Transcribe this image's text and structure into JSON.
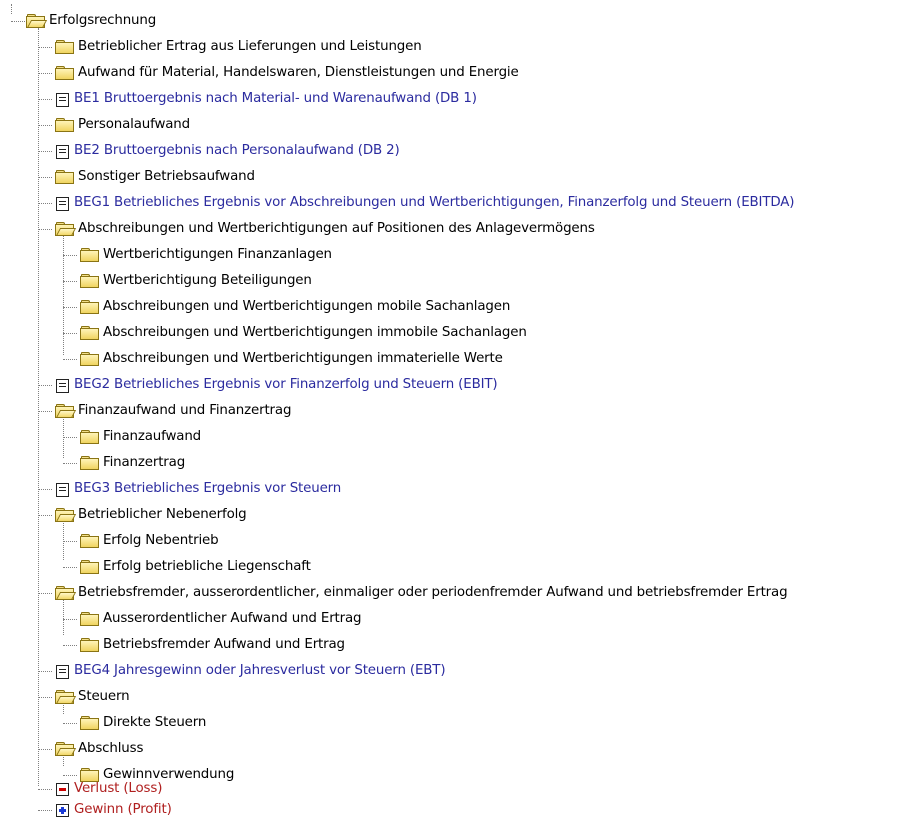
{
  "tree": {
    "root": {
      "label": "Erfolgsrechnung",
      "icon": "folder-open-icon",
      "color": "#000000"
    },
    "items": [
      {
        "label": "Betrieblicher Ertrag aus Lieferungen und Leistungen",
        "icon": "folder-icon",
        "color": "#000000"
      },
      {
        "label": "Aufwand für Material, Handelswaren, Dienstleistungen und Energie",
        "icon": "folder-icon",
        "color": "#000000"
      },
      {
        "label": "BE1 Bruttoergebnis nach Material- und Warenaufwand (DB 1)",
        "icon": "document-icon",
        "color": "#2b2b9f"
      },
      {
        "label": "Personalaufwand",
        "icon": "folder-icon",
        "color": "#000000"
      },
      {
        "label": "BE2 Bruttoergebnis nach Personalaufwand  (DB 2)",
        "icon": "document-icon",
        "color": "#2b2b9f"
      },
      {
        "label": "Sonstiger Betriebsaufwand",
        "icon": "folder-icon",
        "color": "#000000"
      },
      {
        "label": "BEG1 Betriebliches Ergebnis vor Abschreibungen und Wertberichtigungen, Finanzerfolg und Steuern (EBITDA)",
        "icon": "document-icon",
        "color": "#2b2b9f"
      },
      {
        "label": "Abschreibungen und Wertberichtigungen auf Positionen des Anlagevermögens",
        "icon": "folder-open-icon",
        "color": "#000000"
      },
      {
        "label": "Wertberichtigungen Finanzanlagen",
        "icon": "folder-icon",
        "color": "#000000"
      },
      {
        "label": "Wertberichtigung Beteiligungen",
        "icon": "folder-icon",
        "color": "#000000"
      },
      {
        "label": "Abschreibungen und Wertberichtigungen mobile Sachanlagen",
        "icon": "folder-icon",
        "color": "#000000"
      },
      {
        "label": "Abschreibungen und Wertberichtigungen immobile Sachanlagen",
        "icon": "folder-icon",
        "color": "#000000"
      },
      {
        "label": "Abschreibungen und Wertberichtigungen immaterielle Werte",
        "icon": "folder-icon",
        "color": "#000000"
      },
      {
        "label": "BEG2 Betriebliches Ergebnis vor Finanzerfolg und Steuern (EBIT)",
        "icon": "document-icon",
        "color": "#2b2b9f"
      },
      {
        "label": "Finanzaufwand und Finanzertrag",
        "icon": "folder-open-icon",
        "color": "#000000"
      },
      {
        "label": "Finanzaufwand",
        "icon": "folder-icon",
        "color": "#000000"
      },
      {
        "label": "Finanzertrag",
        "icon": "folder-icon",
        "color": "#000000"
      },
      {
        "label": "BEG3 Betriebliches Ergebnis vor Steuern",
        "icon": "document-icon",
        "color": "#2b2b9f"
      },
      {
        "label": "Betrieblicher Nebenerfolg",
        "icon": "folder-open-icon",
        "color": "#000000"
      },
      {
        "label": "Erfolg Nebentrieb",
        "icon": "folder-icon",
        "color": "#000000"
      },
      {
        "label": "Erfolg betriebliche Liegenschaft",
        "icon": "folder-icon",
        "color": "#000000"
      },
      {
        "label": "Betriebsfremder, ausserordentlicher, einmaliger oder periodenfremder Aufwand und betriebsfremder Ertrag",
        "icon": "folder-open-icon",
        "color": "#000000"
      },
      {
        "label": "Ausserordentlicher Aufwand und Ertrag",
        "icon": "folder-icon",
        "color": "#000000"
      },
      {
        "label": "Betriebsfremder Aufwand und Ertrag",
        "icon": "folder-icon",
        "color": "#000000"
      },
      {
        "label": "BEG4 Jahresgewinn oder Jahresverlust vor Steuern (EBT)",
        "icon": "document-icon",
        "color": "#2b2b9f"
      },
      {
        "label": "Steuern",
        "icon": "folder-open-icon",
        "color": "#000000"
      },
      {
        "label": "Direkte Steuern",
        "icon": "folder-icon",
        "color": "#000000"
      },
      {
        "label": "Abschluss",
        "icon": "folder-open-icon",
        "color": "#000000"
      },
      {
        "label": "Gewinnverwendung",
        "icon": "folder-icon",
        "color": "#000000"
      },
      {
        "label": "Verlust (Loss)",
        "icon": "minus-box-icon",
        "color": "#b02020"
      },
      {
        "label": "Gewinn (Profit)",
        "icon": "plus-box-icon",
        "color": "#b02020"
      }
    ]
  }
}
